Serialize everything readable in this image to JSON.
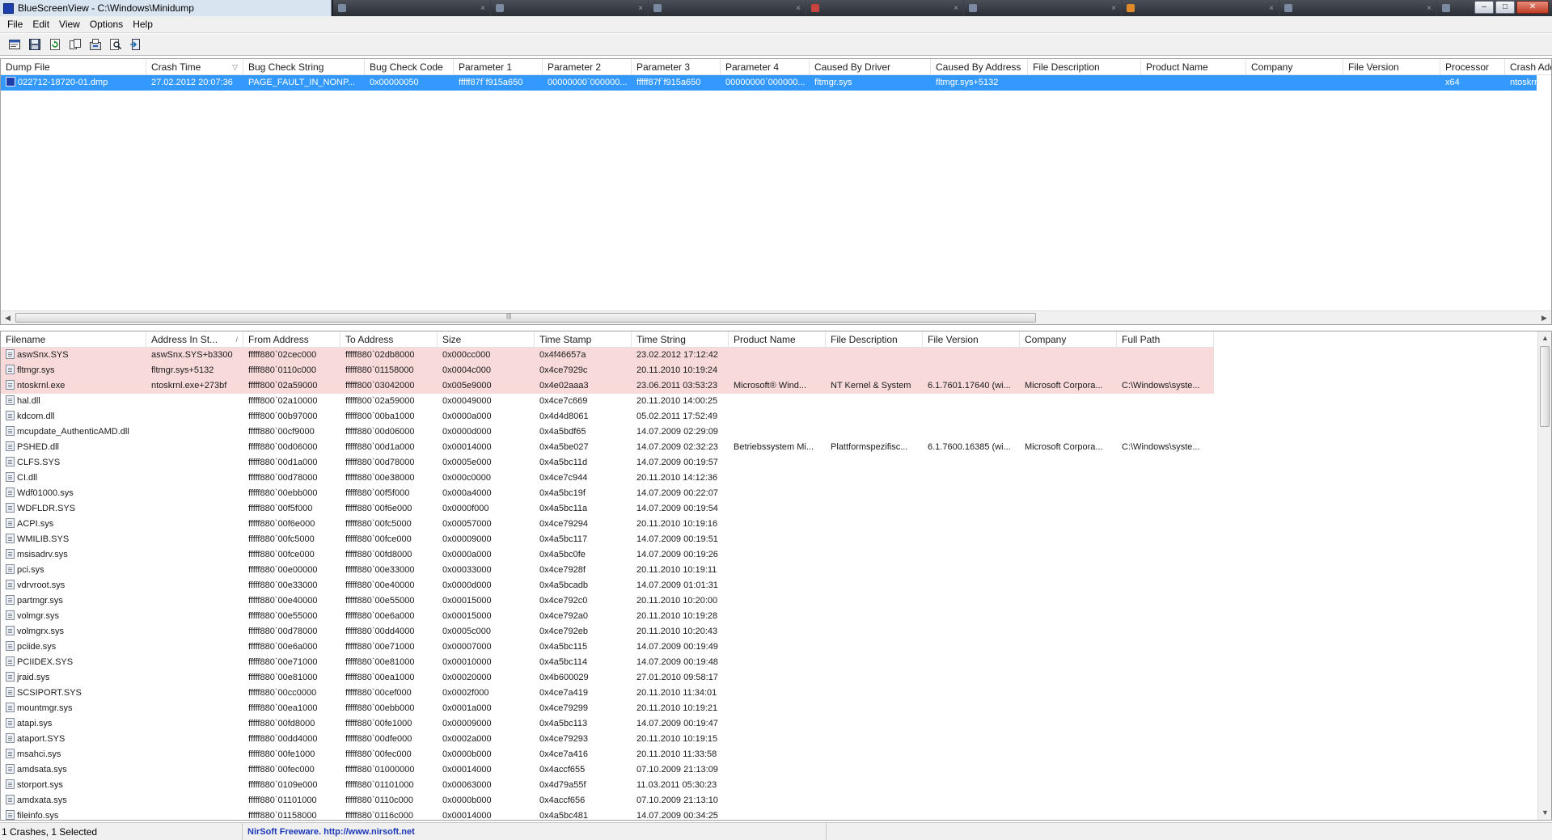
{
  "window": {
    "title": "BlueScreenView  -  C:\\Windows\\Minidump",
    "taskbar_tabs": [
      "",
      "",
      "",
      "",
      "",
      "",
      "",
      ""
    ],
    "controls": {
      "minimize": "–",
      "maximize": "□",
      "close": "✕"
    }
  },
  "menu": [
    "File",
    "Edit",
    "View",
    "Options",
    "Help"
  ],
  "toolbar": [
    "properties-icon",
    "save-icon",
    "refresh-icon",
    "copy-icon",
    "advanced-options-icon",
    "find-icon",
    "exit-icon"
  ],
  "crash_list": {
    "columns": [
      "Dump File",
      "Crash Time",
      "Bug Check String",
      "Bug Check Code",
      "Parameter 1",
      "Parameter 2",
      "Parameter 3",
      "Parameter 4",
      "Caused By Driver",
      "Caused By Address",
      "File Description",
      "Product Name",
      "Company",
      "File Version",
      "Processor",
      "Crash Add"
    ],
    "sort_glyph": "▽",
    "rows": [
      [
        "022712-18720-01.dmp",
        "27.02.2012 20:07:36",
        "PAGE_FAULT_IN_NONP...",
        "0x00000050",
        "fffff87f`f915a650",
        "00000000`000000...",
        "fffff87f`f915a650",
        "00000000`000000...",
        "fltmgr.sys",
        "fltmgr.sys+5132",
        "",
        "",
        "",
        "",
        "x64",
        "ntoskrnl.e"
      ]
    ]
  },
  "driver_list": {
    "columns": [
      "Filename",
      "Address In St...",
      "From Address",
      "To Address",
      "Size",
      "Time Stamp",
      "Time String",
      "Product Name",
      "File Description",
      "File Version",
      "Company",
      "Full Path"
    ],
    "sort_glyph": "/",
    "rows": [
      [
        "aswSnx.SYS",
        "aswSnx.SYS+b3300",
        "fffff880`02cec000",
        "fffff880`02db8000",
        "0x000cc000",
        "0x4f46657a",
        "23.02.2012 17:12:42",
        "",
        "",
        "",
        "",
        ""
      ],
      [
        "fltmgr.sys",
        "fltmgr.sys+5132",
        "fffff880`0110c000",
        "fffff880`01158000",
        "0x0004c000",
        "0x4ce7929c",
        "20.11.2010 10:19:24",
        "",
        "",
        "",
        "",
        ""
      ],
      [
        "ntoskrnl.exe",
        "ntoskrnl.exe+273bf",
        "fffff800`02a59000",
        "fffff800`03042000",
        "0x005e9000",
        "0x4e02aaa3",
        "23.06.2011 03:53:23",
        "Microsoft® Wind...",
        "NT Kernel & System",
        "6.1.7601.17640 (wi...",
        "Microsoft Corpora...",
        "C:\\Windows\\syste..."
      ],
      [
        "hal.dll",
        "",
        "fffff800`02a10000",
        "fffff800`02a59000",
        "0x00049000",
        "0x4ce7c669",
        "20.11.2010 14:00:25",
        "",
        "",
        "",
        "",
        ""
      ],
      [
        "kdcom.dll",
        "",
        "fffff800`00b97000",
        "fffff800`00ba1000",
        "0x0000a000",
        "0x4d4d8061",
        "05.02.2011 17:52:49",
        "",
        "",
        "",
        "",
        ""
      ],
      [
        "mcupdate_AuthenticAMD.dll",
        "",
        "fffff880`00cf9000",
        "fffff880`00d06000",
        "0x0000d000",
        "0x4a5bdf65",
        "14.07.2009 02:29:09",
        "",
        "",
        "",
        "",
        ""
      ],
      [
        "PSHED.dll",
        "",
        "fffff880`00d06000",
        "fffff880`00d1a000",
        "0x00014000",
        "0x4a5be027",
        "14.07.2009 02:32:23",
        "Betriebssystem Mi...",
        "Plattformspezifisc...",
        "6.1.7600.16385 (wi...",
        "Microsoft Corpora...",
        "C:\\Windows\\syste..."
      ],
      [
        "CLFS.SYS",
        "",
        "fffff880`00d1a000",
        "fffff880`00d78000",
        "0x0005e000",
        "0x4a5bc11d",
        "14.07.2009 00:19:57",
        "",
        "",
        "",
        "",
        ""
      ],
      [
        "CI.dll",
        "",
        "fffff880`00d78000",
        "fffff880`00e38000",
        "0x000c0000",
        "0x4ce7c944",
        "20.11.2010 14:12:36",
        "",
        "",
        "",
        "",
        ""
      ],
      [
        "Wdf01000.sys",
        "",
        "fffff880`00ebb000",
        "fffff880`00f5f000",
        "0x000a4000",
        "0x4a5bc19f",
        "14.07.2009 00:22:07",
        "",
        "",
        "",
        "",
        ""
      ],
      [
        "WDFLDR.SYS",
        "",
        "fffff880`00f5f000",
        "fffff880`00f6e000",
        "0x0000f000",
        "0x4a5bc11a",
        "14.07.2009 00:19:54",
        "",
        "",
        "",
        "",
        ""
      ],
      [
        "ACPI.sys",
        "",
        "fffff880`00f6e000",
        "fffff880`00fc5000",
        "0x00057000",
        "0x4ce79294",
        "20.11.2010 10:19:16",
        "",
        "",
        "",
        "",
        ""
      ],
      [
        "WMILIB.SYS",
        "",
        "fffff880`00fc5000",
        "fffff880`00fce000",
        "0x00009000",
        "0x4a5bc117",
        "14.07.2009 00:19:51",
        "",
        "",
        "",
        "",
        ""
      ],
      [
        "msisadrv.sys",
        "",
        "fffff880`00fce000",
        "fffff880`00fd8000",
        "0x0000a000",
        "0x4a5bc0fe",
        "14.07.2009 00:19:26",
        "",
        "",
        "",
        "",
        ""
      ],
      [
        "pci.sys",
        "",
        "fffff880`00e00000",
        "fffff880`00e33000",
        "0x00033000",
        "0x4ce7928f",
        "20.11.2010 10:19:11",
        "",
        "",
        "",
        "",
        ""
      ],
      [
        "vdrvroot.sys",
        "",
        "fffff880`00e33000",
        "fffff880`00e40000",
        "0x0000d000",
        "0x4a5bcadb",
        "14.07.2009 01:01:31",
        "",
        "",
        "",
        "",
        ""
      ],
      [
        "partmgr.sys",
        "",
        "fffff880`00e40000",
        "fffff880`00e55000",
        "0x00015000",
        "0x4ce792c0",
        "20.11.2010 10:20:00",
        "",
        "",
        "",
        "",
        ""
      ],
      [
        "volmgr.sys",
        "",
        "fffff880`00e55000",
        "fffff880`00e6a000",
        "0x00015000",
        "0x4ce792a0",
        "20.11.2010 10:19:28",
        "",
        "",
        "",
        "",
        ""
      ],
      [
        "volmgrx.sys",
        "",
        "fffff880`00d78000",
        "fffff880`00dd4000",
        "0x0005c000",
        "0x4ce792eb",
        "20.11.2010 10:20:43",
        "",
        "",
        "",
        "",
        ""
      ],
      [
        "pciide.sys",
        "",
        "fffff880`00e6a000",
        "fffff880`00e71000",
        "0x00007000",
        "0x4a5bc115",
        "14.07.2009 00:19:49",
        "",
        "",
        "",
        "",
        ""
      ],
      [
        "PCIIDEX.SYS",
        "",
        "fffff880`00e71000",
        "fffff880`00e81000",
        "0x00010000",
        "0x4a5bc114",
        "14.07.2009 00:19:48",
        "",
        "",
        "",
        "",
        ""
      ],
      [
        "jraid.sys",
        "",
        "fffff880`00e81000",
        "fffff880`00ea1000",
        "0x00020000",
        "0x4b600029",
        "27.01.2010 09:58:17",
        "",
        "",
        "",
        "",
        ""
      ],
      [
        "SCSIPORT.SYS",
        "",
        "fffff880`00cc0000",
        "fffff880`00cef000",
        "0x0002f000",
        "0x4ce7a419",
        "20.11.2010 11:34:01",
        "",
        "",
        "",
        "",
        ""
      ],
      [
        "mountmgr.sys",
        "",
        "fffff880`00ea1000",
        "fffff880`00ebb000",
        "0x0001a000",
        "0x4ce79299",
        "20.11.2010 10:19:21",
        "",
        "",
        "",
        "",
        ""
      ],
      [
        "atapi.sys",
        "",
        "fffff880`00fd8000",
        "fffff880`00fe1000",
        "0x00009000",
        "0x4a5bc113",
        "14.07.2009 00:19:47",
        "",
        "",
        "",
        "",
        ""
      ],
      [
        "ataport.SYS",
        "",
        "fffff880`00dd4000",
        "fffff880`00dfe000",
        "0x0002a000",
        "0x4ce79293",
        "20.11.2010 10:19:15",
        "",
        "",
        "",
        "",
        ""
      ],
      [
        "msahci.sys",
        "",
        "fffff880`00fe1000",
        "fffff880`00fec000",
        "0x0000b000",
        "0x4ce7a416",
        "20.11.2010 11:33:58",
        "",
        "",
        "",
        "",
        ""
      ],
      [
        "amdsata.sys",
        "",
        "fffff880`00fec000",
        "fffff880`01000000",
        "0x00014000",
        "0x4accf655",
        "07.10.2009 21:13:09",
        "",
        "",
        "",
        "",
        ""
      ],
      [
        "storport.sys",
        "",
        "fffff880`0109e000",
        "fffff880`01101000",
        "0x00063000",
        "0x4d79a55f",
        "11.03.2011 05:30:23",
        "",
        "",
        "",
        "",
        ""
      ],
      [
        "amdxata.sys",
        "",
        "fffff880`01101000",
        "fffff880`0110c000",
        "0x0000b000",
        "0x4accf656",
        "07.10.2009 21:13:10",
        "",
        "",
        "",
        "",
        ""
      ],
      [
        "fileinfo.sys",
        "",
        "fffff880`01158000",
        "fffff880`0116c000",
        "0x00014000",
        "0x4a5bc481",
        "14.07.2009 00:34:25",
        "",
        "",
        "",
        "",
        ""
      ]
    ]
  },
  "status": {
    "left": "1 Crashes, 1 Selected",
    "mid": "NirSoft Freeware.  http://www.nirsoft.net"
  },
  "colors": {
    "selection": "#3399ff",
    "highlight_row": "#f8dada",
    "link": "#1b37b8"
  }
}
